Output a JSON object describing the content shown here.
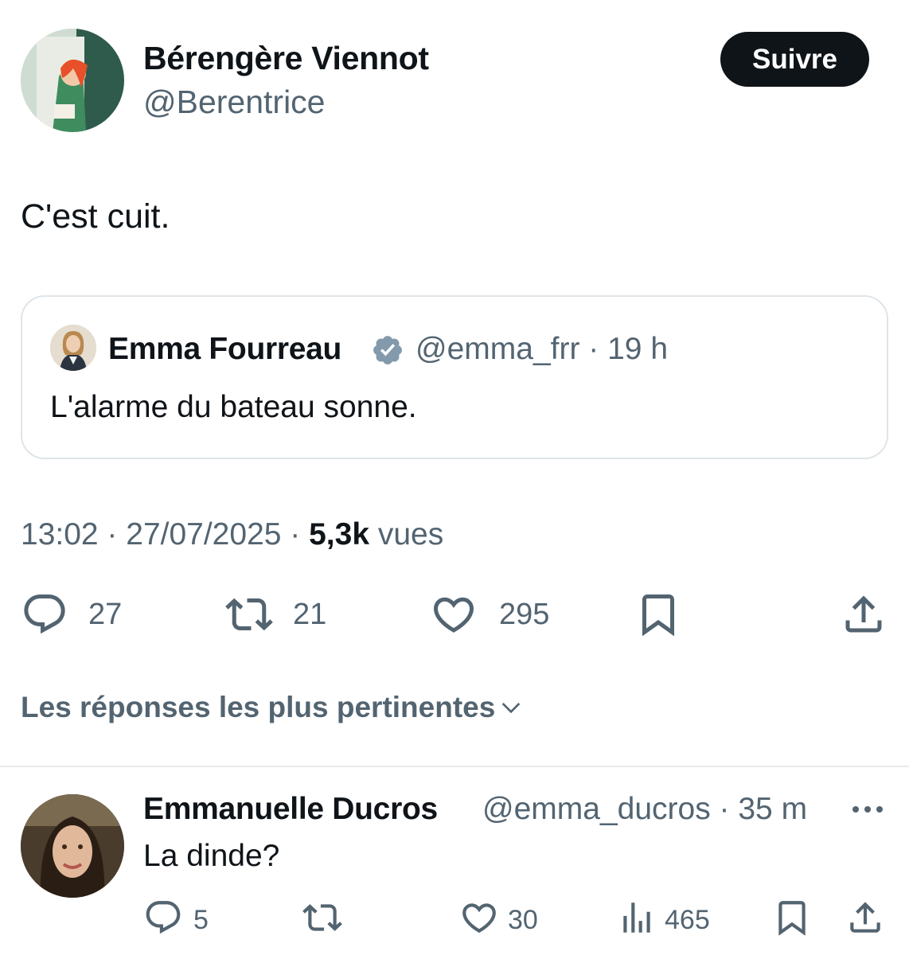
{
  "tweet": {
    "author_name": "Bérengère Viennot",
    "author_handle": "@Berentrice",
    "follow_label": "Suivre",
    "text": "C'est cuit.",
    "quoted": {
      "author_name": "Emma Fourreau",
      "author_handle": "@emma_frr",
      "meta": "@emma_frr · 19 h",
      "text": "L'alarme du bateau sonne."
    },
    "time_date": "13:02 · 27/07/2025 · ",
    "views_count": "5,3k",
    "views_label": "vues",
    "actions": {
      "replies": "27",
      "reposts": "21",
      "likes": "295"
    }
  },
  "replies_sort_label": "Les réponses les plus pertinentes",
  "reply": {
    "author_name": "Emmanuelle Ducros",
    "meta": "@emma_ducros · 35 m",
    "text": "La dinde?",
    "actions": {
      "replies": "5",
      "likes": "30",
      "views": "465"
    }
  },
  "colors": {
    "text_primary": "#0f1419",
    "text_secondary": "#536471",
    "verified_badge": "#829aab",
    "border": "#dfe5e9"
  },
  "icons": [
    "reply-icon",
    "repost-icon",
    "like-icon",
    "bookmark-icon",
    "share-icon",
    "views-icon",
    "verified-badge-icon",
    "chevron-down-icon",
    "more-icon"
  ]
}
